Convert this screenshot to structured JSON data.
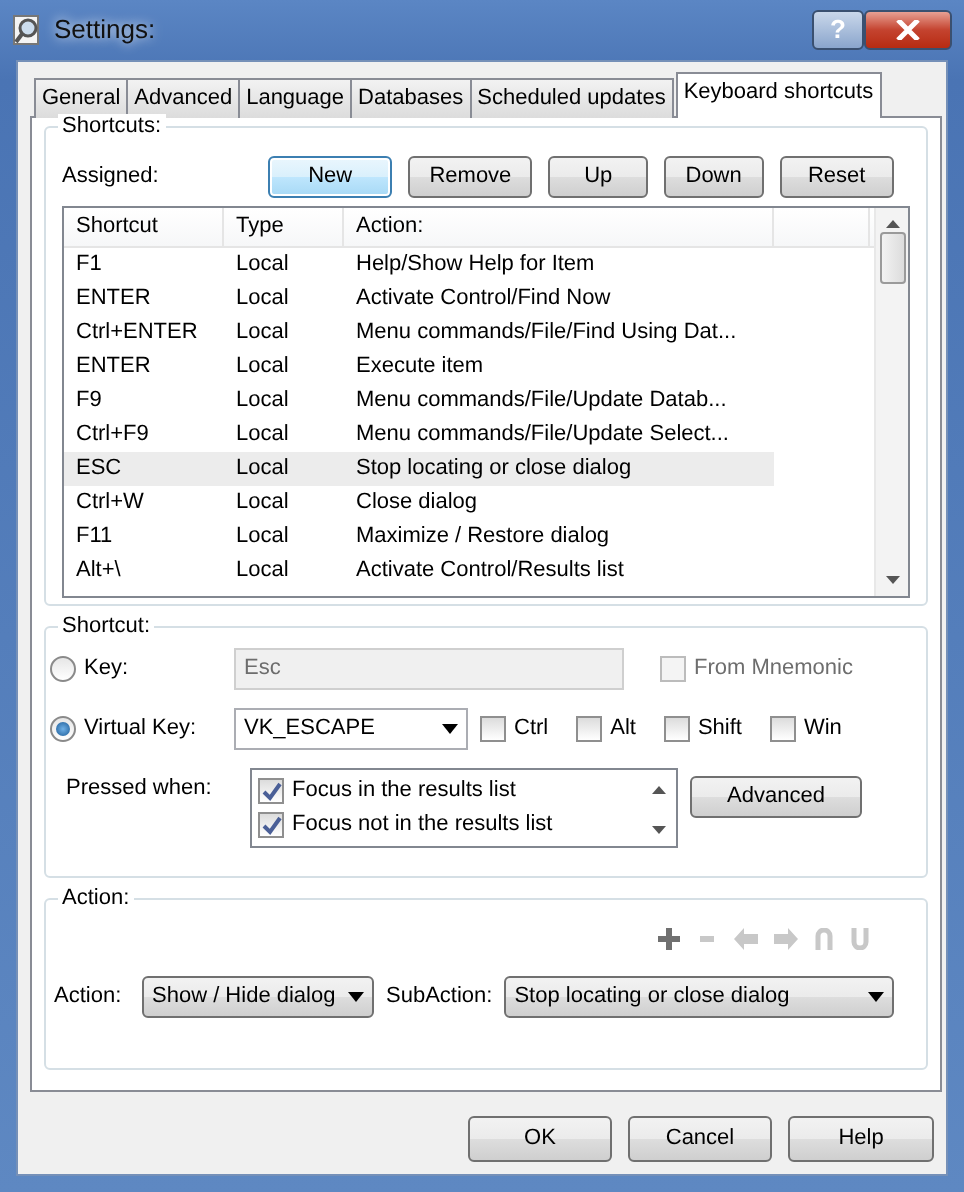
{
  "window": {
    "title": "Settings:",
    "help_button": "?"
  },
  "tabs": [
    {
      "label": "General",
      "selected": false
    },
    {
      "label": "Advanced",
      "selected": false
    },
    {
      "label": "Language",
      "selected": false
    },
    {
      "label": "Databases",
      "selected": false
    },
    {
      "label": "Scheduled updates",
      "selected": false
    },
    {
      "label": "Keyboard shortcuts",
      "selected": true
    }
  ],
  "shortcuts": {
    "title": "Shortcuts:",
    "assigned_label": "Assigned:",
    "buttons": [
      {
        "label": "New",
        "focused": true
      },
      {
        "label": "Remove",
        "focused": false
      },
      {
        "label": "Up",
        "focused": false
      },
      {
        "label": "Down",
        "focused": false
      },
      {
        "label": "Reset",
        "focused": false
      }
    ],
    "table": {
      "columns": [
        "Shortcut",
        "Type",
        "Action:"
      ],
      "rows": [
        {
          "cells": [
            "F1",
            "Local",
            "Help/Show Help for Item"
          ],
          "selected": false
        },
        {
          "cells": [
            "ENTER",
            "Local",
            "Activate Control/Find Now"
          ],
          "selected": false
        },
        {
          "cells": [
            "Ctrl+ENTER",
            "Local",
            "Menu commands/File/Find Using Dat..."
          ],
          "selected": false
        },
        {
          "cells": [
            "ENTER",
            "Local",
            "Execute item"
          ],
          "selected": false
        },
        {
          "cells": [
            "F9",
            "Local",
            "Menu commands/File/Update Datab..."
          ],
          "selected": false
        },
        {
          "cells": [
            "Ctrl+F9",
            "Local",
            "Menu commands/File/Update Select..."
          ],
          "selected": false
        },
        {
          "cells": [
            "ESC",
            "Local",
            "Stop locating or close dialog"
          ],
          "selected": true
        },
        {
          "cells": [
            "Ctrl+W",
            "Local",
            "Close dialog"
          ],
          "selected": false
        },
        {
          "cells": [
            "F11",
            "Local",
            "Maximize / Restore dialog"
          ],
          "selected": false
        },
        {
          "cells": [
            "Alt+\\",
            "Local",
            "Activate Control/Results list"
          ],
          "selected": false
        }
      ]
    }
  },
  "shortcut": {
    "title": "Shortcut:",
    "key": {
      "label": "Key:",
      "selected": false,
      "value": "Esc",
      "disabled": true
    },
    "from_mnemonic": {
      "label": "From Mnemonic",
      "checked": false,
      "disabled": true
    },
    "virtual_key": {
      "label": "Virtual Key:",
      "selected": true,
      "value": "VK_ESCAPE"
    },
    "modifiers": [
      {
        "label": "Ctrl",
        "checked": false
      },
      {
        "label": "Alt",
        "checked": false
      },
      {
        "label": "Shift",
        "checked": false
      },
      {
        "label": "Win",
        "checked": false
      }
    ],
    "pressed_when_label": "Pressed when:",
    "conditions": [
      {
        "label": "Focus in the results list",
        "checked": true
      },
      {
        "label": "Focus not in the results list",
        "checked": true
      }
    ],
    "advanced_button": "Advanced"
  },
  "action": {
    "title": "Action:",
    "action_label": "Action:",
    "action_value": "Show / Hide dialog",
    "subaction_label": "SubAction:",
    "subaction_value": "Stop locating or close dialog"
  },
  "footer_buttons": [
    "OK",
    "Cancel",
    "Help"
  ]
}
